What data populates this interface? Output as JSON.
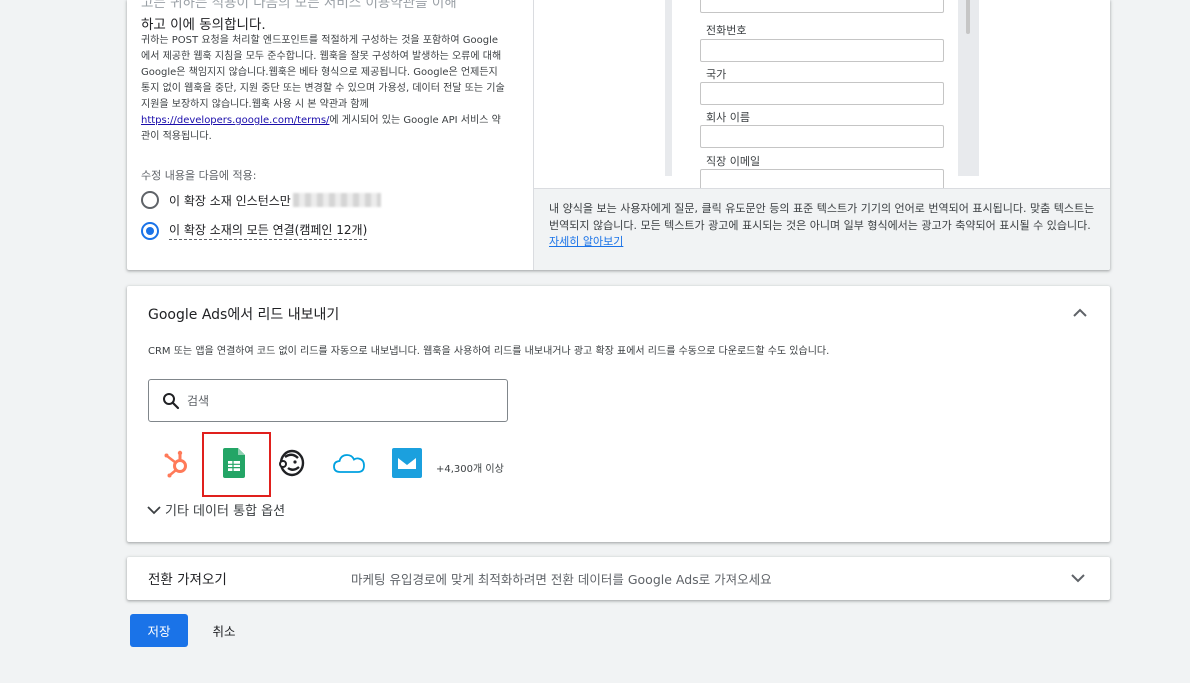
{
  "consent": {
    "heading_line1": "고는 귀하는 적용이 다음의 모든 서비스 이용약관을 이해",
    "heading_line2": "하고 이에 동의합니다.",
    "terms_part1": "귀하는 POST 요청을 처리할 엔드포인트를 적절하게 구성하는 것을 포함하여 Google에서 제공한 웹훅 지침을 모두 준수합니다. 웹훅을 잘못 구성하여 발생하는 오류에 대해 Google은 책임지지 않습니다.웹훅은 베타 형식으로 제공됩니다. Google은 언제든지 통지 없이 웹훅을 중단, 지원 중단 또는 변경할 수 있으며 가용성, 데이터 전달 또는 기술 지원을 보장하지 않습니다.웹훅 사용 시 본 약관과 함께",
    "terms_link": "https://developers.google.com/terms/",
    "terms_part2": "에 게시되어 있는 Google API 서비스 약관이 적용됩니다."
  },
  "apply": {
    "label": "수정 내용을 다음에 적용:",
    "option_instance": "이 확장 소재 인스턴스만",
    "option_all": "이 확장 소재의 모든 연결(캠페인 12개)",
    "selected": "option_all"
  },
  "preview": {
    "fields": [
      "전화번호",
      "국가",
      "회사 이름",
      "직장 이메일"
    ],
    "note": "내 양식을 보는 사용자에게 질문, 클릭 유도문안 등의 표준 텍스트가 기기의 언어로 번역되어 표시됩니다. 맞춤 텍스트는 번역되지 않습니다. 모든 텍스트가 광고에 표시되는 것은 아니며 일부 형식에서는 광고가 축약되어 표시될 수 있습니다.",
    "learn_more": "자세히 알아보기"
  },
  "export": {
    "title": "Google Ads에서 리드 내보내기",
    "description": "CRM 또는 앱을 연결하여 코드 없이 리드를 자동으로 내보냅니다. 웹훅을 사용하여 리드를 내보내거나 광고 확장 표에서 리드를 수동으로 다운로드할 수도 있습니다.",
    "search_placeholder": "검색",
    "integrations": [
      "hubspot-icon",
      "google-sheets-icon",
      "mailchimp-icon",
      "salesforce-icon",
      "campaign-monitor-icon"
    ],
    "more_count": "+4,300개 이상",
    "more_options": "기타 데이터 통합 옵션",
    "colors": {
      "hubspot": "#ff7a59",
      "sheets": "#23a566",
      "salesforce": "#00a1e0",
      "campaign_monitor": "#1ba0de"
    }
  },
  "conversion": {
    "title": "전환 가져오기",
    "description": "마케팅 유입경로에 맞게 최적화하려면 전환 데이터를 Google Ads로 가져오세요"
  },
  "actions": {
    "save": "저장",
    "cancel": "취소",
    "accent": "#1a73e8"
  }
}
